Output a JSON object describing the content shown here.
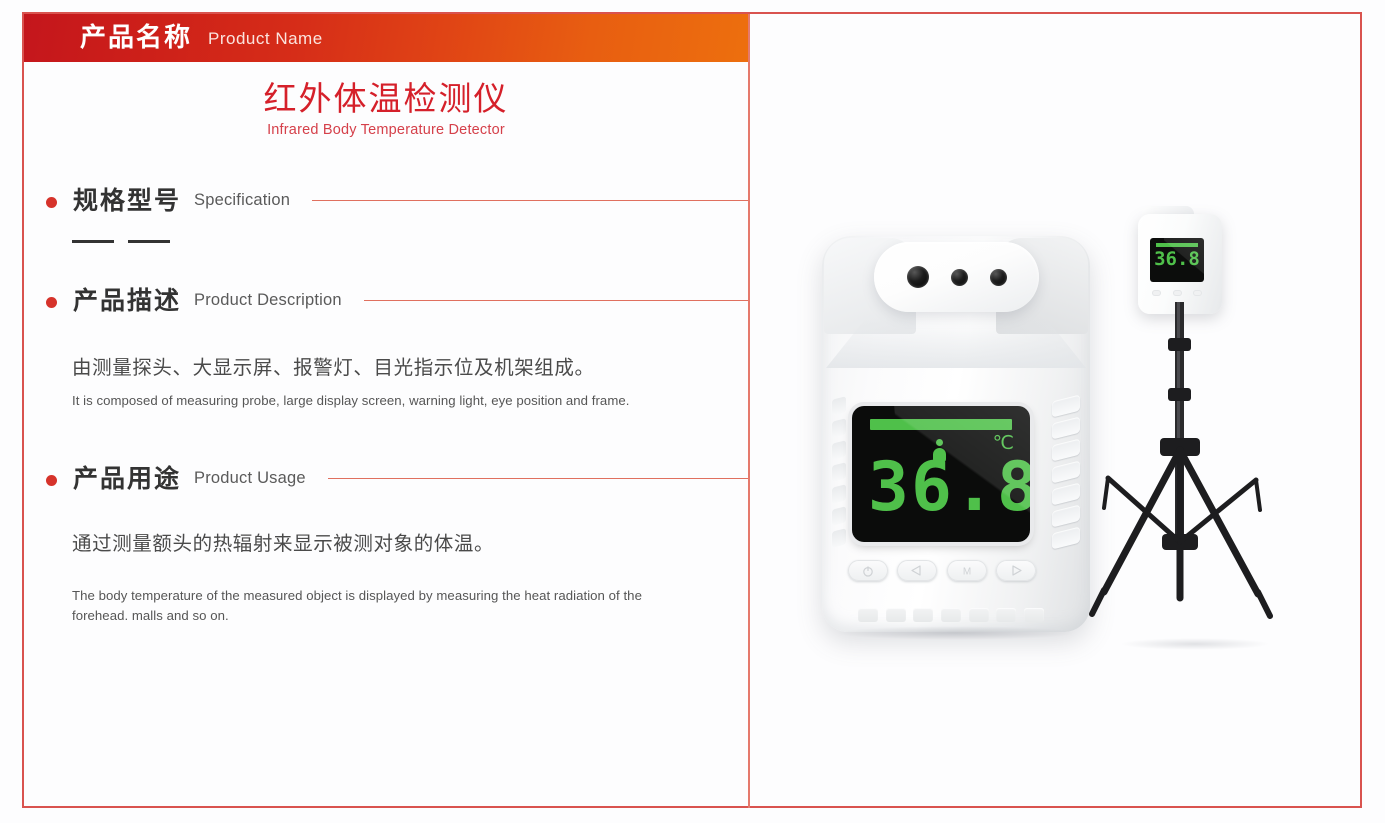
{
  "header": {
    "title_zh": "产品名称",
    "title_en": "Product Name"
  },
  "product": {
    "name_zh": "红外体温检测仪",
    "name_en": "Infrared Body Temperature Detector"
  },
  "sections": [
    {
      "id": "specification",
      "title_zh": "规格型号",
      "title_en": "Specification",
      "value_placeholder": "—— ——"
    },
    {
      "id": "product-description",
      "title_zh": "产品描述",
      "title_en": "Product Description",
      "body_zh": "由测量探头、大显示屏、报警灯、目光指示位及机架组成。",
      "body_en": "It is composed of measuring probe, large display screen, warning light, eye position and frame."
    },
    {
      "id": "product-usage",
      "title_zh": "产品用途",
      "title_en": "Product Usage",
      "body_zh": "通过测量额头的热辐射来显示被测对象的体温。",
      "body_en": "The body temperature of the measured object is displayed by measuring the heat radiation of the forehead. malls and so on."
    }
  ],
  "device": {
    "display_value": "36.8",
    "display_unit": "℃",
    "buttons": [
      "power",
      "left",
      "mode",
      "right"
    ],
    "button_labels": {
      "power": "⏻",
      "left": "◀",
      "mode": "M",
      "right": "▶"
    }
  },
  "tripod_device": {
    "display_value": "36.8"
  },
  "colors": {
    "header_gradient_start": "#c4161c",
    "header_gradient_end": "#ed6f0e",
    "title_red": "#d5202a",
    "bullet_red": "#d6332b",
    "rule_salmon": "#e0705f",
    "frame_red": "#d9534f",
    "lcd_green": "#4fc04a"
  }
}
